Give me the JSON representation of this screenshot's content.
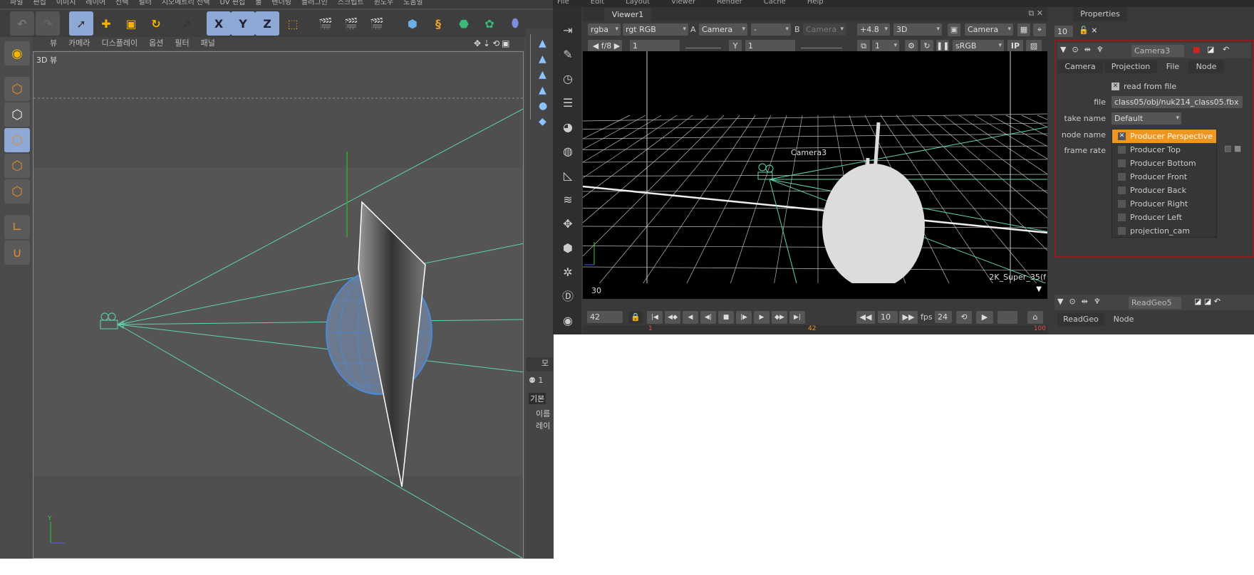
{
  "c4d": {
    "menu": [
      "파일",
      "편집",
      "이미지",
      "레이어",
      "선택",
      "필터",
      "지오메트리 선택",
      "UV 편집",
      "툴",
      "렌더링",
      "플러그인",
      "스크립트",
      "윈도우",
      "도움말"
    ],
    "viewport_menu": [
      "뷰",
      "카메라",
      "디스플레이",
      "옵션",
      "필터",
      "패널"
    ],
    "viewport_title": "3D 뷰",
    "axis_labels": {
      "x": "X",
      "y": "Y",
      "z": "Z"
    },
    "right_panel": {
      "header": "모",
      "count": "1",
      "tab": "기본",
      "fields": [
        "이름",
        "레이"
      ]
    }
  },
  "nuke": {
    "menu": [
      "File",
      "Edit",
      "Layout",
      "Viewer",
      "Render",
      "Cache",
      "Help"
    ],
    "viewer_tab": "Viewer1",
    "toolbar1": {
      "channels": "rgba",
      "layer": "rgt RGB",
      "a_label": "A",
      "a_input": "Camera",
      "mid": "-",
      "b_label": "B",
      "b_input": "Camera",
      "gain": "+4.8",
      "mode": "3D",
      "camera": "Camera"
    },
    "toolbar2": {
      "fstop": "f/8",
      "gain_value": "1",
      "y_label": "Y",
      "gamma_value": "1",
      "proxy": "1",
      "lut": "sRGB",
      "ip": "IP"
    },
    "viewer": {
      "camera_label": "Camera3",
      "format": "2K_Super_35(f"
    },
    "timeline": {
      "frame_field": "30",
      "current_frame": "42",
      "step": "10",
      "fps_label": "fps",
      "fps": "24",
      "start": "1",
      "marker": "42",
      "end": "100"
    },
    "properties": {
      "tab": "Properties",
      "max_panels": "10",
      "node1": {
        "name": "Camera3",
        "tabs": [
          "Camera",
          "Projection",
          "File",
          "Node"
        ],
        "active_tab": "File",
        "read_from_file": "read from file",
        "read_checked": true,
        "file_label": "file",
        "file_value": "class05/obj/nuk214_class05.fbx",
        "take_label": "take name",
        "take_value": "Default",
        "node_label": "node name",
        "frame_label": "frame rate",
        "node_options": [
          {
            "label": "Producer Perspective",
            "selected": true
          },
          {
            "label": "Producer Top",
            "selected": false
          },
          {
            "label": "Producer Bottom",
            "selected": false
          },
          {
            "label": "Producer Front",
            "selected": false
          },
          {
            "label": "Producer Back",
            "selected": false
          },
          {
            "label": "Producer Right",
            "selected": false
          },
          {
            "label": "Producer Left",
            "selected": false
          },
          {
            "label": "projection_cam",
            "selected": false
          }
        ]
      },
      "node2": {
        "name": "ReadGeo5",
        "tabs": [
          "ReadGeo",
          "Node"
        ]
      }
    }
  },
  "colors": {
    "frustum": "#5fd3b0",
    "highlight": "#f0961e",
    "wireframe": "#4a8ad8",
    "node_border": "#8a1f1f"
  }
}
